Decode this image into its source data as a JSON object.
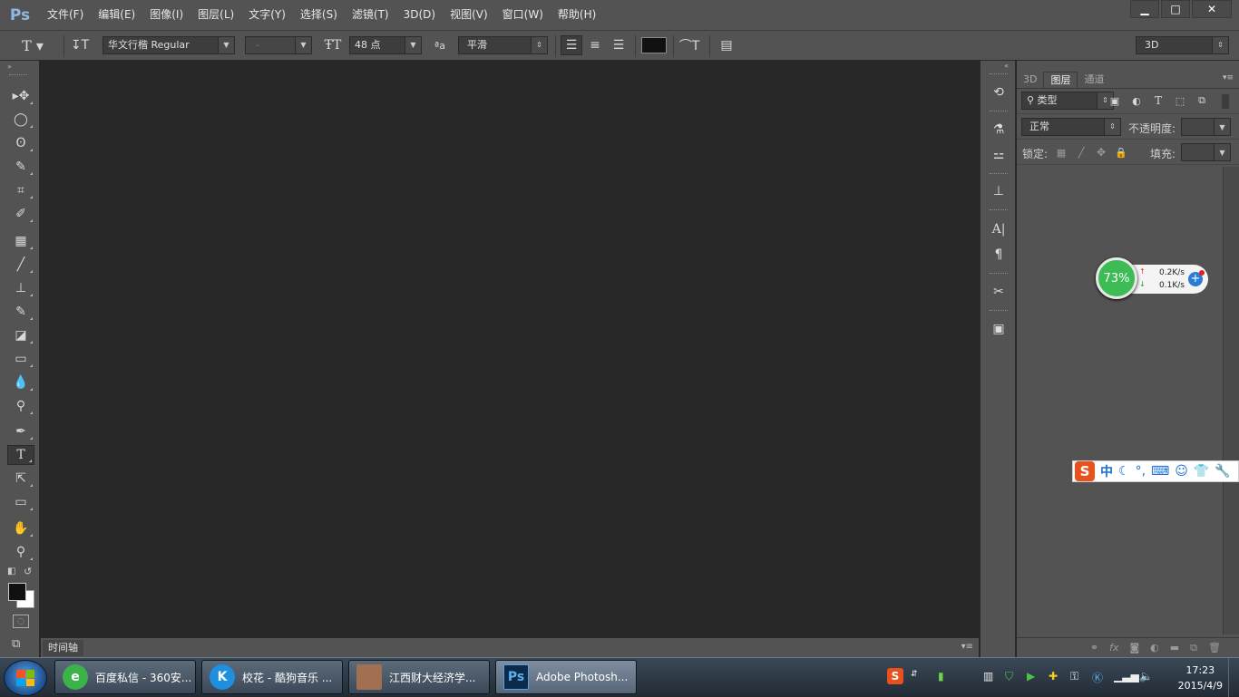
{
  "app": {
    "logo": "Ps"
  },
  "menu": [
    "文件(F)",
    "编辑(E)",
    "图像(I)",
    "图层(L)",
    "文字(Y)",
    "选择(S)",
    "滤镜(T)",
    "3D(D)",
    "视图(V)",
    "窗口(W)",
    "帮助(H)"
  ],
  "window_controls": {
    "minimize": "▁",
    "maximize": "□",
    "close": "✕"
  },
  "options": {
    "font_family": "华文行楷 Regular",
    "font_style": "-",
    "font_size": "48 点",
    "aa_label": "ªa",
    "antialias": "平滑",
    "workspace": "3D",
    "text_color": "#111111"
  },
  "tools": [
    {
      "name": "move-tool-icon",
      "glyph": "▸✥"
    },
    {
      "name": "marquee-tool-icon",
      "glyph": "◯"
    },
    {
      "name": "lasso-tool-icon",
      "glyph": "ʘ"
    },
    {
      "name": "quick-select-tool-icon",
      "glyph": "✎"
    },
    {
      "name": "crop-tool-icon",
      "glyph": "⌗"
    },
    {
      "name": "eyedropper-tool-icon",
      "glyph": "✐"
    },
    {
      "name": "healing-brush-tool-icon",
      "glyph": "▦"
    },
    {
      "name": "brush-tool-icon",
      "glyph": "╱"
    },
    {
      "name": "clone-stamp-tool-icon",
      "glyph": "⊥"
    },
    {
      "name": "history-brush-tool-icon",
      "glyph": "✎"
    },
    {
      "name": "eraser-tool-icon",
      "glyph": "◪"
    },
    {
      "name": "gradient-tool-icon",
      "glyph": "▭"
    },
    {
      "name": "blur-tool-icon",
      "glyph": "💧"
    },
    {
      "name": "dodge-tool-icon",
      "glyph": "⚲"
    },
    {
      "name": "pen-tool-icon",
      "glyph": "✒"
    },
    {
      "name": "type-tool-icon",
      "glyph": "T"
    },
    {
      "name": "path-select-tool-icon",
      "glyph": "⇱"
    },
    {
      "name": "rectangle-tool-icon",
      "glyph": "▭"
    },
    {
      "name": "hand-tool-icon",
      "glyph": "✋"
    },
    {
      "name": "zoom-tool-icon",
      "glyph": "⚲"
    }
  ],
  "colors": {
    "foreground": "#111111",
    "background": "#ffffff"
  },
  "panel": {
    "tabs": [
      "3D",
      "图层",
      "通道"
    ],
    "filter_kind": "⚲ 类型",
    "blend_mode": "正常",
    "opacity_label": "不透明度:",
    "lock_label": "锁定:",
    "fill_label": "填充:"
  },
  "timeline": {
    "tab": "时间轴"
  },
  "network": {
    "percent": "73%",
    "up": "0.2K/s",
    "down": "0.1K/s"
  },
  "ime": {
    "logo": "S",
    "mode": "中"
  },
  "taskbar": {
    "tasks": [
      {
        "label": "百度私信 - 360安...",
        "icon": "e",
        "color": "#3cb24a"
      },
      {
        "label": "校花 - 酷狗音乐 ...",
        "icon": "K",
        "color": "#1f8fe0"
      },
      {
        "label": "江西财大经济学...",
        "icon": "",
        "color": "#a07050"
      },
      {
        "label": "Adobe Photosh...",
        "icon": "Ps",
        "color": "#0c2a4a"
      }
    ],
    "time": "17:23",
    "date": "2015/4/9"
  }
}
